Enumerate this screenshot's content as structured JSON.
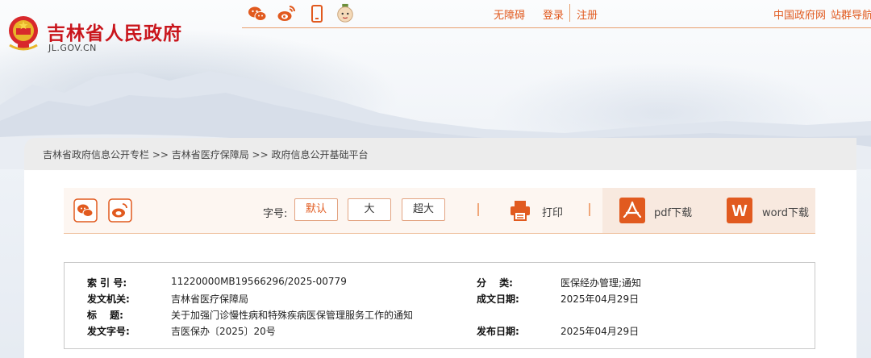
{
  "site": {
    "title": "吉林省人民政府",
    "domain": "JL.GOV.CN"
  },
  "header": {
    "social_icons": [
      "wechat-icon",
      "weibo-icon",
      "mobile-icon",
      "mascot-icon"
    ],
    "links": {
      "accessibility": "无障碍",
      "login": "登录",
      "register": "注册",
      "china_gov": "中国政府网",
      "site_group": "站群导航"
    },
    "accent_color": "#e15a1f",
    "title_color": "#c9161d"
  },
  "breadcrumb": {
    "text": "吉林省政府信息公开专栏 >> 吉林省医疗保障局 >> 政府信息公开基础平台"
  },
  "toolbar": {
    "share_icons": [
      "wechat-share-icon",
      "weibo-share-icon"
    ],
    "font_size_label": "字号:",
    "font_sizes": [
      "默认",
      "大",
      "超大"
    ],
    "selected_font_size": "默认",
    "print_label": "打印",
    "pdf_label": "pdf下载",
    "word_label": "word下载"
  },
  "info": {
    "index_label": "索 引 号:",
    "index_value": "11220000MB19566296/2025-00779",
    "category_label": "分　 类:",
    "category_value": "医保经办管理;通知",
    "issuer_label": "发文机关:",
    "issuer_value": "吉林省医疗保障局",
    "created_label": "成文日期:",
    "created_value": "2025年04月29日",
    "title_label": "标　 题:",
    "title_value": "关于加强门诊慢性病和特殊疾病医保管理服务工作的通知",
    "docno_label": "发文字号:",
    "docno_value": "吉医保办〔2025〕20号",
    "published_label": "发布日期:",
    "published_value": "2025年04月29日"
  }
}
